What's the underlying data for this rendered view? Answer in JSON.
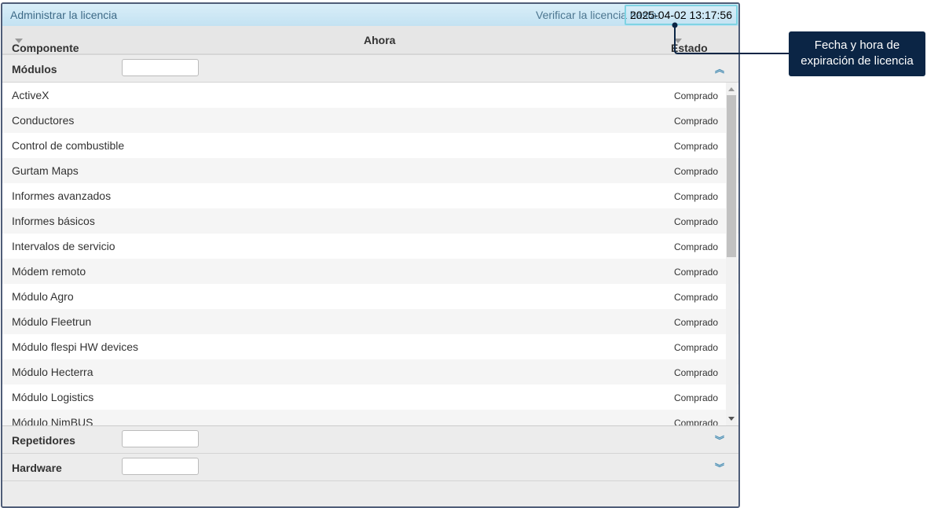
{
  "window": {
    "title": "Administrar la licencia",
    "verify_label": "Verificar la licencia hasta:",
    "verify_date": "2025-04-02 13:17:56"
  },
  "columns": {
    "component": "Componente",
    "now": "Ahora",
    "status": "Estado"
  },
  "sections": [
    {
      "label": "Módulos",
      "expanded": true
    },
    {
      "label": "Repetidores",
      "expanded": false
    },
    {
      "label": "Hardware",
      "expanded": false
    }
  ],
  "modules": [
    {
      "name": "ActiveX",
      "status": "Comprado"
    },
    {
      "name": "Conductores",
      "status": "Comprado"
    },
    {
      "name": "Control de combustible",
      "status": "Comprado"
    },
    {
      "name": "Gurtam Maps",
      "status": "Comprado"
    },
    {
      "name": "Informes avanzados",
      "status": "Comprado"
    },
    {
      "name": "Informes básicos",
      "status": "Comprado"
    },
    {
      "name": "Intervalos de servicio",
      "status": "Comprado"
    },
    {
      "name": "Módem remoto",
      "status": "Comprado"
    },
    {
      "name": "Módulo Agro",
      "status": "Comprado"
    },
    {
      "name": "Módulo Fleetrun",
      "status": "Comprado"
    },
    {
      "name": "Módulo flespi HW devices",
      "status": "Comprado"
    },
    {
      "name": "Módulo Hecterra",
      "status": "Comprado"
    },
    {
      "name": "Módulo Logistics",
      "status": "Comprado"
    },
    {
      "name": "Módulo NimBUS",
      "status": "Comprado"
    }
  ],
  "callout": {
    "text": "Fecha y hora de expiración de licencia"
  }
}
